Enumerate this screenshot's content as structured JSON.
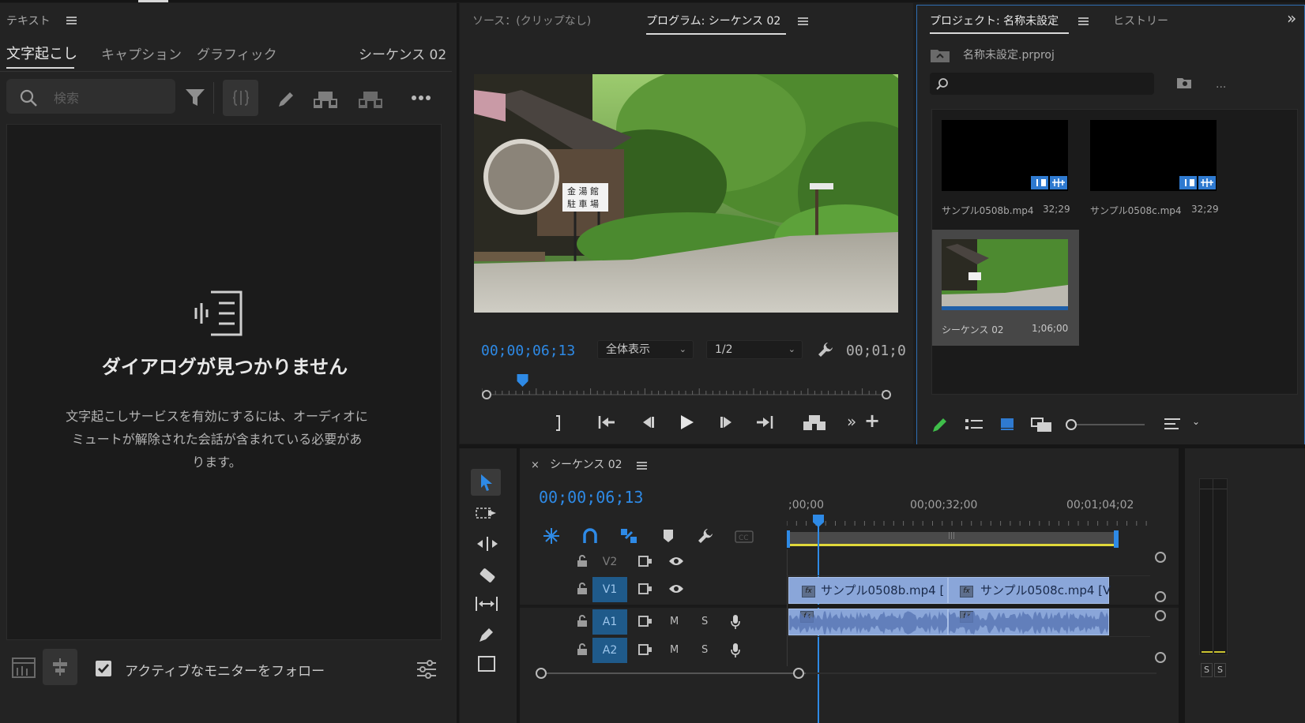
{
  "text_panel": {
    "title": "テキスト",
    "tabs": [
      "文字起こし",
      "キャプション",
      "グラフィック"
    ],
    "sequence_label": "シーケンス 02",
    "search_placeholder": "検索",
    "empty_title": "ダイアログが見つかりません",
    "empty_desc_1": "文字起こしサービスを有効にするには、オーディオに",
    "empty_desc_2": "ミュートが解除された会話が含まれている必要があ",
    "empty_desc_3": "ります。",
    "follow_label": "アクティブなモニターをフォロー",
    "follow_checked": true
  },
  "monitor": {
    "source_tab": "ソース：(クリップなし)",
    "program_tab": "プログラム: シーケンス 02",
    "timecode": "00;00;06;13",
    "fit_option": "全体表示",
    "resolution": "1/2",
    "end_timecode": "00;01;0",
    "playhead_fraction": 0.08
  },
  "project": {
    "tab": "プロジェクト: 名称未設定",
    "history_tab": "ヒストリー",
    "file_name": "名称未設定.prproj",
    "items": [
      {
        "name": "サンプル0508b.mp4",
        "duration": "32;29",
        "type": "clip"
      },
      {
        "name": "サンプル0508c.mp4",
        "duration": "32;29",
        "type": "clip"
      },
      {
        "name": "シーケンス 02",
        "duration": "1;06;00",
        "type": "sequence"
      }
    ]
  },
  "timeline": {
    "sequence_tab": "シーケンス 02",
    "timecode": "00;00;06;13",
    "ruler_labels": [
      ";00;00",
      "00;00;32;00",
      "00;01;04;02"
    ],
    "tracks": {
      "video": [
        {
          "label": "V2",
          "active": false
        },
        {
          "label": "V1",
          "active": true
        }
      ],
      "audio": [
        {
          "label": "A1",
          "active": true
        },
        {
          "label": "A2",
          "active": true
        }
      ]
    },
    "mute_label": "M",
    "solo_label": "S",
    "clips": {
      "v1_b": "サンプル0508b.mp4 [",
      "v1_c": "サンプル0508c.mp4 [V"
    },
    "audio_meter_labels": [
      "S",
      "S"
    ]
  },
  "colors": {
    "accent_blue": "#2e8ae6",
    "clip_blue": "#8aa6d9",
    "panel_bg": "#232323",
    "selected_border": "#2e6eb3"
  },
  "icons": {
    "transcript_empty": "transcript-icon",
    "search": "search-icon",
    "filter": "filter-icon"
  }
}
